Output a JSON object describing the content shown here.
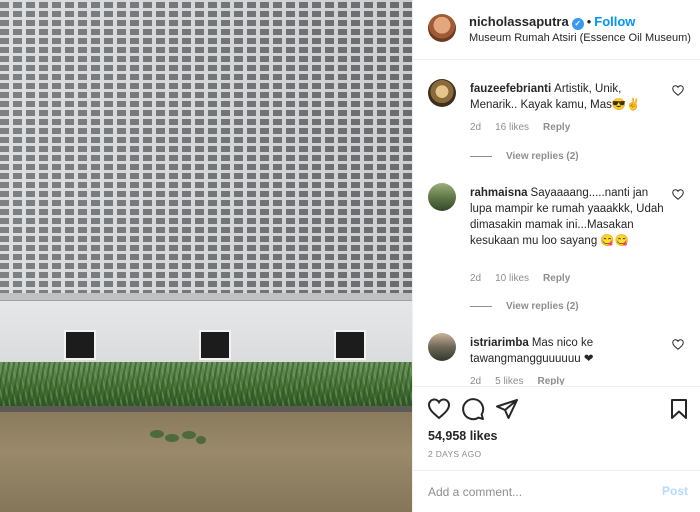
{
  "post": {
    "username": "nicholassaputra",
    "follow_label": "Follow",
    "separator": "•",
    "location": "Museum Rumah Atsiri (Essence Oil Museum)"
  },
  "comments": [
    {
      "username": "fauzeefebrianti",
      "text": "Artistik, Unik, Menarik.. Kayak kamu, Mas😎✌",
      "age": "2d",
      "likes": "16 likes",
      "reply_label": "Reply",
      "view_replies": "View replies (2)"
    },
    {
      "username": "rahmaisna",
      "text": "Sayaaaang.....nanti jan lupa mampir ke rumah yaaakkk, Udah dimasakin mamak ini...Masakan kesukaan mu loo sayang 😋😋",
      "age": "2d",
      "likes": "10 likes",
      "reply_label": "Reply",
      "view_replies": "View replies (2)"
    },
    {
      "username": "istriarimba",
      "text": "Mas nico ke tawangmangguuuuuu ❤",
      "age": "2d",
      "likes": "5 likes",
      "reply_label": "Reply"
    }
  ],
  "stats": {
    "likes": "54,958 likes",
    "posted": "2 DAYS AGO"
  },
  "composer": {
    "placeholder": "Add a comment...",
    "post_label": "Post"
  },
  "colors": {
    "accent": "#0095f6",
    "post_disabled": "#b3dbff",
    "heart_red": "#ed4956",
    "muted": "#8e8e8e"
  },
  "icons": [
    "verified-badge-icon",
    "heart-icon",
    "comment-icon",
    "share-icon",
    "bookmark-icon",
    "heart-small-icon"
  ]
}
